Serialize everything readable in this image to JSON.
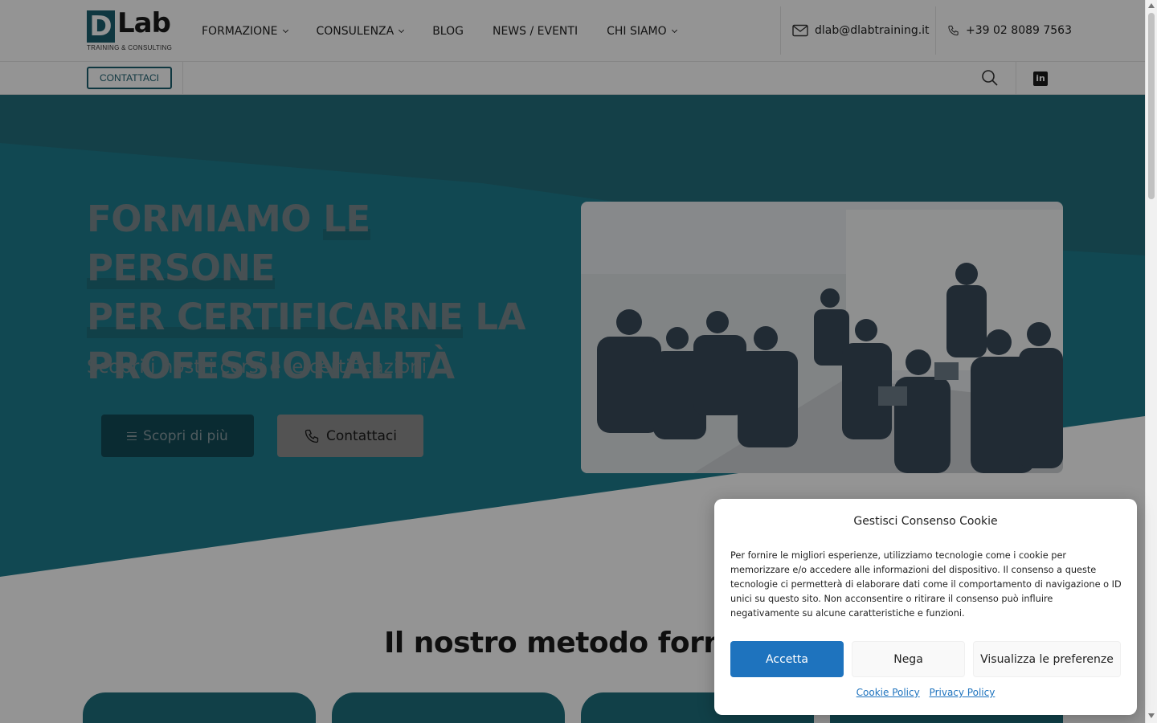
{
  "header": {
    "logo": {
      "letter": "D",
      "word": "Lab",
      "tagline": "TRAINING & CONSULTING"
    },
    "nav": [
      {
        "label": "FORMAZIONE",
        "dropdown": true
      },
      {
        "label": "CONSULENZA",
        "dropdown": true
      },
      {
        "label": "BLOG",
        "dropdown": false
      },
      {
        "label": "NEWS / EVENTI",
        "dropdown": false
      },
      {
        "label": "CHI SIAMO",
        "dropdown": true
      }
    ],
    "email": "dlab@dlabtraining.it",
    "phone": "+39 02 8089 7563",
    "contact_button": "CONTATTACI",
    "linkedin_glyph": "in"
  },
  "hero": {
    "title_line1_a": "FORMIAMO ",
    "title_line1_b": "LE PERSONE",
    "title_line2_a": "PER CERTIFICARNE",
    "title_line2_b": " LA",
    "title_line3": "PROFESSIONALITÀ",
    "subtitle": "Scopri i nostri corsi e le certificazioni",
    "btn_more": "Scopri di più",
    "btn_contact": "Contattaci"
  },
  "section": {
    "title": "Il nostro metodo formativo"
  },
  "cookie": {
    "title": "Gestisci Consenso Cookie",
    "text": "Per fornire le migliori esperienze, utilizziamo tecnologie come i cookie per memorizzare e/o accedere alle informazioni del dispositivo. Il consenso a queste tecnologie ci permetterà di elaborare dati come il comportamento di navigazione o ID unici su questo sito. Non acconsentire o ritirare il consenso può influire negativamente su alcune caratteristiche e funzioni.",
    "accept": "Accetta",
    "deny": "Nega",
    "preferences": "Visualizza le preferenze",
    "cookie_policy": "Cookie Policy",
    "privacy_policy": "Privacy Policy"
  },
  "colors": {
    "brand": "#1b5f6f",
    "accent_teal": "#1e6e7d",
    "accept_blue": "#1e73be"
  },
  "icons": [
    "mail-icon",
    "phone-icon",
    "search-icon",
    "linkedin-icon",
    "menu-icon",
    "chevron-down-icon"
  ]
}
